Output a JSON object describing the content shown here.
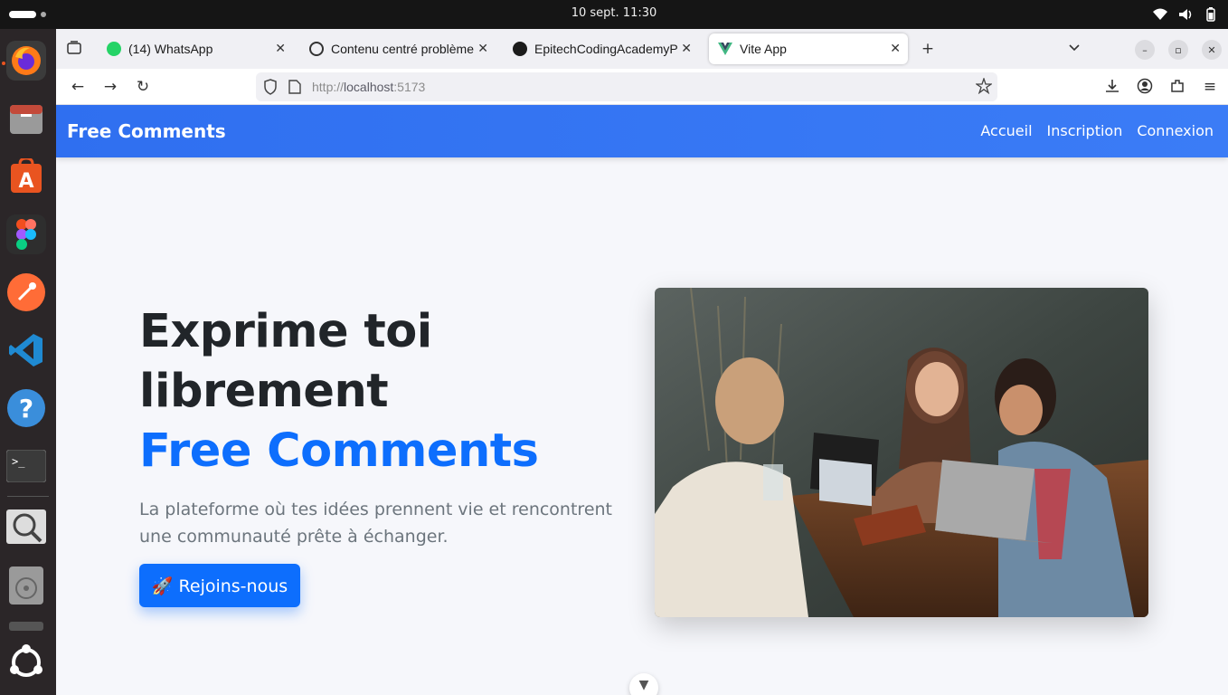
{
  "system": {
    "datetime": "10 sept.  11:30"
  },
  "browser": {
    "tabs": [
      {
        "title": "(14) WhatsApp",
        "badge": "14"
      },
      {
        "title": "Contenu centré problème"
      },
      {
        "title": "EpitechCodingAcademyP"
      },
      {
        "title": "Vite App"
      }
    ],
    "url_scheme": "http://",
    "url_host": "localhost",
    "url_port": ":5173"
  },
  "site": {
    "brand": "Free Comments",
    "nav": [
      "Accueil",
      "Inscription",
      "Connexion"
    ],
    "hero": {
      "line1": "Exprime toi",
      "line2": "librement",
      "accent": "Free Comments",
      "subtitle": "La plateforme où tes idées prennent vie et rencontrent une communauté prête à échanger.",
      "cta": "🚀 Rejoins-nous"
    }
  },
  "colors": {
    "primary": "#0d6efd",
    "nav_bg": "#3174f1",
    "heading": "#212529",
    "muted": "#6c757d"
  }
}
